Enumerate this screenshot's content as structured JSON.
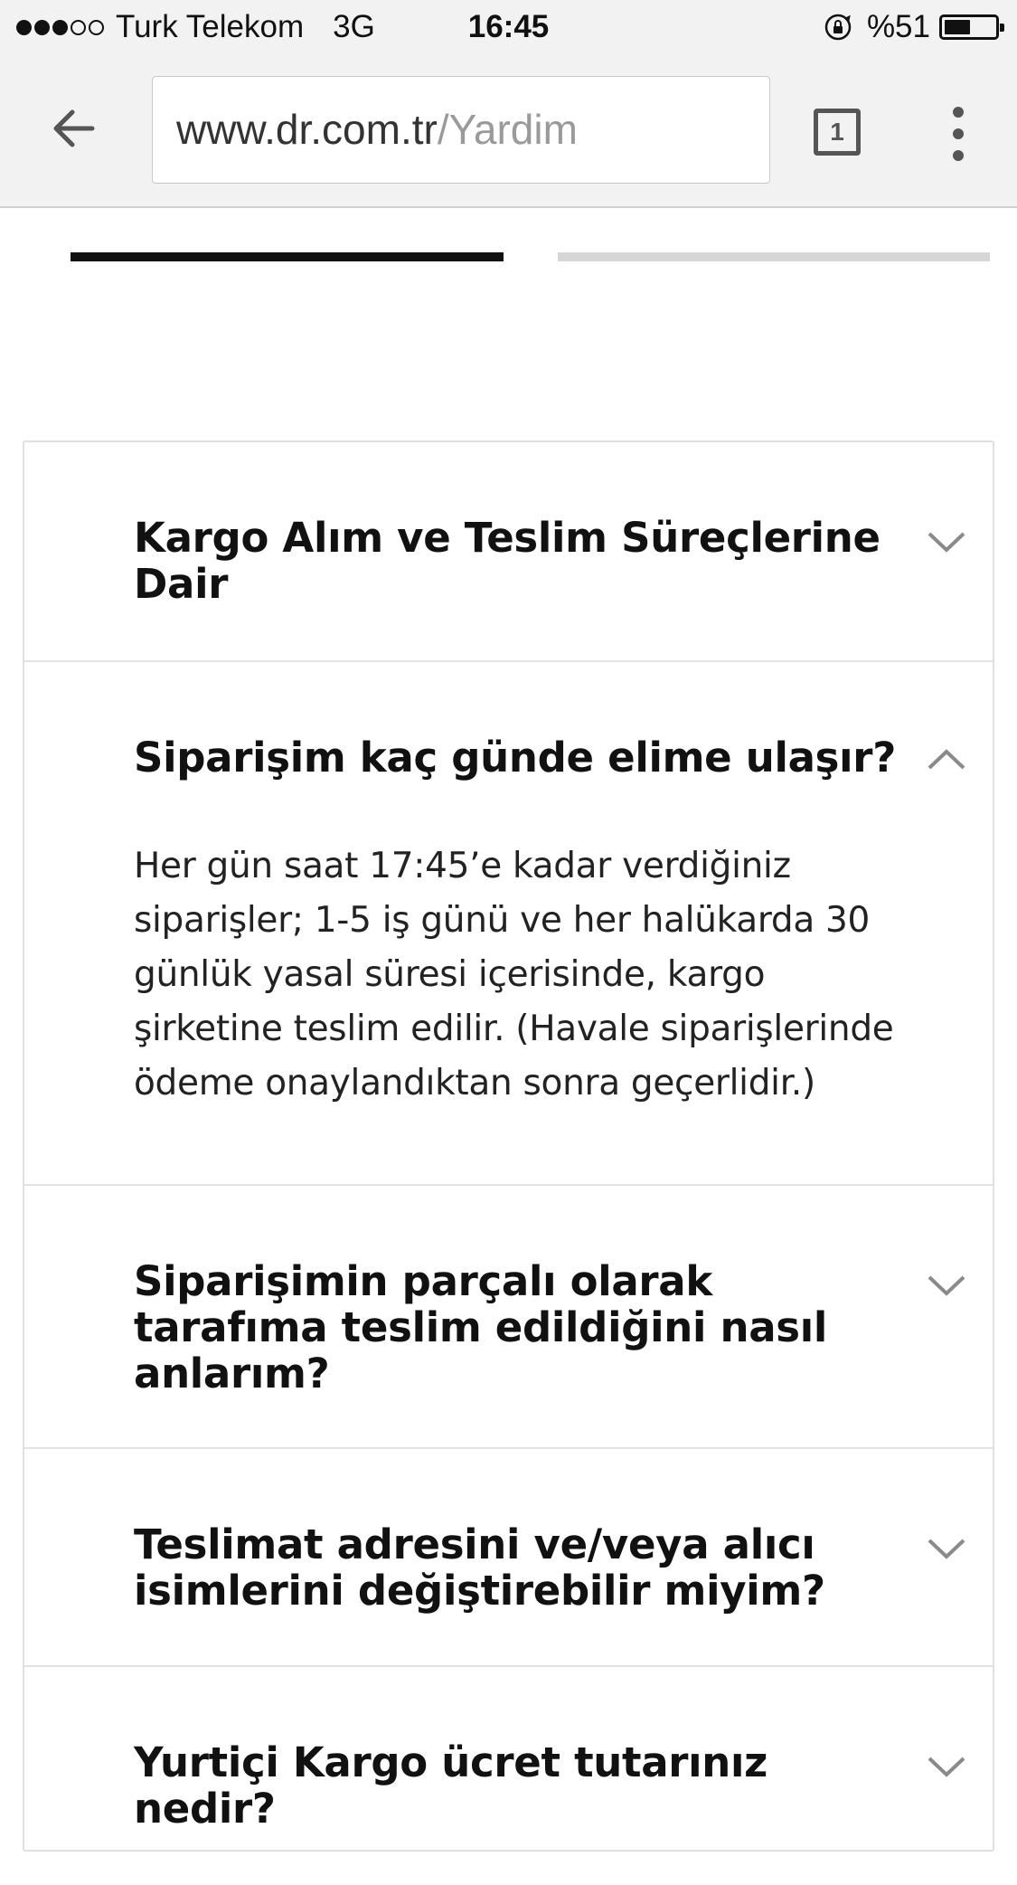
{
  "status_bar": {
    "carrier": "Turk Telekom",
    "network": "3G",
    "time": "16:45",
    "battery_text": "%51",
    "battery_level": 0.51,
    "signal_bars_filled": 3,
    "signal_bars_total": 5,
    "icons": [
      "signal-dots-icon",
      "orientation-lock-icon",
      "battery-icon"
    ]
  },
  "browser": {
    "url_host": "www.dr.com.tr",
    "url_path": "/Yardim",
    "tab_count": "1",
    "icons": [
      "back-arrow-icon",
      "tabs-icon",
      "overflow-menu-icon"
    ]
  },
  "tabs": {
    "active_index": 0,
    "count": 2
  },
  "faq": {
    "items": [
      {
        "question": "Kargo Alım ve Teslim Süreçlerine Dair",
        "expanded": false
      },
      {
        "question": "Siparişim kaç günde elime ulaşır?",
        "expanded": true,
        "answer": "Her gün saat 17:45’e kadar verdiğiniz siparişler; 1-5 iş günü ve her halükarda 30 günlük yasal süresi içerisinde, kargo şirketine teslim edilir. (Havale siparişlerinde ödeme onaylandıktan sonra geçerlidir.)"
      },
      {
        "question": "Siparişimin parçalı olarak tarafıma teslim edildiğini nasıl anlarım?",
        "expanded": false
      },
      {
        "question": "Teslimat adresini ve/veya alıcı isimlerini değiştirebilir miyim?",
        "expanded": false
      },
      {
        "question": "Yurtiçi Kargo ücret tutarınız nedir?",
        "expanded": false
      }
    ]
  },
  "colors": {
    "chrome_bg": "#f2f2f2",
    "text": "#111111",
    "url_path": "#9a9a9a",
    "divider": "#e3e3e3",
    "tab_active": "#111111",
    "tab_inactive": "#d6d6d6",
    "chevron": "#8a8a8a"
  }
}
